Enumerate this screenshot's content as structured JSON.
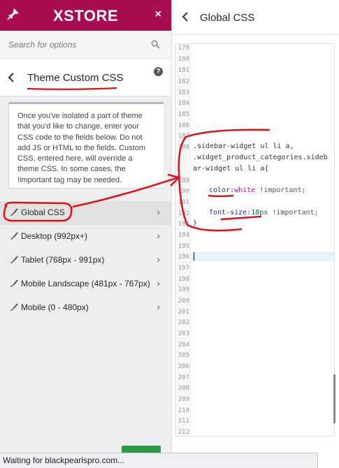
{
  "sidebar": {
    "brand": "XSTORE",
    "close_glyph": "×",
    "search_placeholder": "Search for options",
    "section_title": "Theme Custom CSS",
    "help_glyph": "?",
    "description": "Once you've isolated a part of theme that you'd like to change, enter your CSS code to the fields below. Do not add JS or HTML to the fields. Custom CSS, entered here, will override a theme CSS. In some cases, the !important tag may be needed.",
    "items": [
      {
        "label": "Global CSS",
        "icon": "brush-icon",
        "active": true
      },
      {
        "label": "Desktop (992px+)",
        "icon": "brush-icon"
      },
      {
        "label": "Tablet (768px - 991px)",
        "icon": "brush-icon"
      },
      {
        "label": "Mobile Landscape (481px - 767px)",
        "icon": "brush-icon"
      },
      {
        "label": "Mobile (0 - 480px)",
        "icon": "brush-icon"
      }
    ]
  },
  "panel": {
    "title": "Global CSS"
  },
  "editor": {
    "line_numbers": [
      "179",
      "180",
      "181",
      "182",
      "183",
      "184",
      "185",
      "186",
      "187",
      "188",
      "189",
      "190",
      "191",
      "192",
      "193",
      "194",
      "195",
      "196",
      "197",
      "198",
      "199",
      "200",
      "201",
      "202",
      "203",
      "204",
      "205",
      "206",
      "207",
      "208",
      "209",
      "210",
      "211",
      "212"
    ],
    "code": {
      "line188a": ".sidebar-widget ul li a,",
      "line188b": ".widget_product_categories.sideb",
      "line188c": "ar-widget ul li a{",
      "color_prop": "color",
      "color_val": "white",
      "important1": " !important;",
      "fontsize_prop": "font-size",
      "fontsize_val": "18px",
      "important2": " !important;",
      "close_brace": "}"
    }
  },
  "status": {
    "text": "Waiting for blackpearlspro.com..."
  },
  "colors": {
    "brand": "#a70d4f",
    "annotation": "#e0101a",
    "publish": "#2e9a44"
  }
}
